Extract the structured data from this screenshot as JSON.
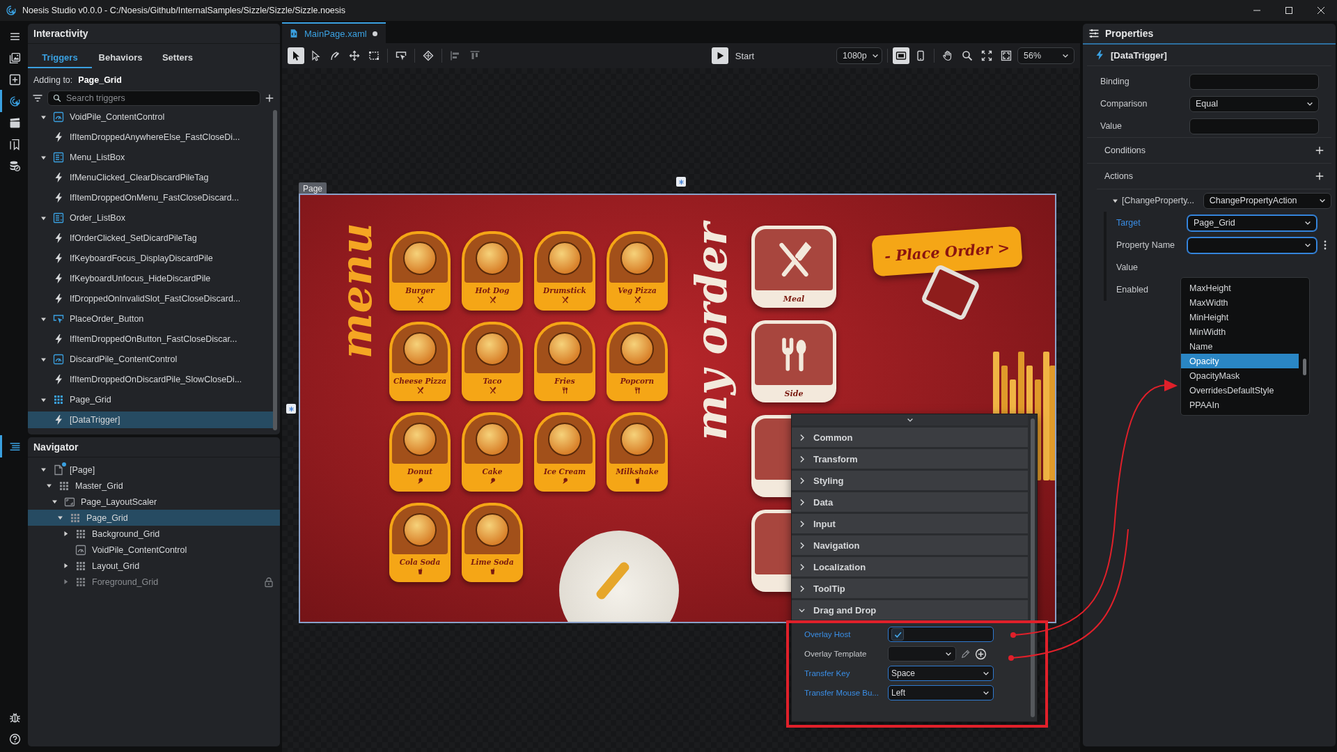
{
  "title_bar": {
    "title": "Noesis Studio v0.0.0 - C:/Noesis/Github/InternalSamples/Sizzle/Sizzle/Sizzle.noesis"
  },
  "activity_bar": {
    "panels": [
      {
        "kind": "menu",
        "selected": false
      },
      {
        "kind": "images",
        "selected": false
      },
      {
        "kind": "add",
        "selected": false
      },
      {
        "kind": "interactivity",
        "selected": true
      },
      {
        "kind": "film",
        "selected": false
      },
      {
        "kind": "pages",
        "selected": false
      },
      {
        "kind": "database",
        "selected": false
      }
    ],
    "navigator": [
      {
        "kind": "outline",
        "selected": true
      }
    ],
    "footer": [
      {
        "kind": "bug"
      },
      {
        "kind": "help"
      }
    ]
  },
  "interactivity": {
    "title": "Interactivity",
    "tabs": [
      {
        "label": "Triggers",
        "selected": true
      },
      {
        "label": "Behaviors",
        "selected": false
      },
      {
        "label": "Setters",
        "selected": false
      }
    ],
    "adding_to_label": "Adding to:",
    "adding_to_value": "Page_Grid",
    "search": {
      "placeholder": "Search triggers"
    },
    "tree": [
      {
        "label": "VoidPile_ContentControl",
        "kind": "contentcontrol",
        "expanded": true,
        "selected": false,
        "children": [
          {
            "label": "IfItemDroppedAnywhereElse_FastCloseDi...",
            "kind": "trigger",
            "selected": false
          }
        ]
      },
      {
        "label": "Menu_ListBox",
        "kind": "listbox",
        "expanded": true,
        "selected": false,
        "children": [
          {
            "label": "IfMenuClicked_ClearDiscardPileTag",
            "kind": "trigger",
            "selected": false
          },
          {
            "label": "IfItemDroppedOnMenu_FastCloseDiscard...",
            "kind": "trigger",
            "selected": false
          }
        ]
      },
      {
        "label": "Order_ListBox",
        "kind": "listbox",
        "expanded": true,
        "selected": false,
        "children": [
          {
            "label": "IfOrderClicked_SetDicardPileTag",
            "kind": "trigger",
            "selected": false
          },
          {
            "label": "IfKeyboardFocus_DisplayDiscardPile",
            "kind": "trigger",
            "selected": false
          },
          {
            "label": "IfKeyboardUnfocus_HideDiscardPile",
            "kind": "trigger",
            "selected": false
          },
          {
            "label": "IfDroppedOnInvalidSlot_FastCloseDiscard...",
            "kind": "trigger",
            "selected": false
          }
        ]
      },
      {
        "label": "PlaceOrder_Button",
        "kind": "button",
        "expanded": true,
        "selected": false,
        "children": [
          {
            "label": "IfItemDroppedOnButton_FastCloseDiscar...",
            "kind": "trigger",
            "selected": false
          }
        ]
      },
      {
        "label": "DiscardPile_ContentControl",
        "kind": "contentcontrol",
        "expanded": true,
        "selected": false,
        "children": [
          {
            "label": "IfItemDroppedOnDiscardPile_SlowCloseDi...",
            "kind": "trigger",
            "selected": false
          }
        ]
      },
      {
        "label": "Page_Grid",
        "kind": "grid",
        "expanded": true,
        "selected": false,
        "children": [
          {
            "label": "[DataTrigger]",
            "kind": "trigger",
            "selected": true
          }
        ]
      }
    ]
  },
  "navigator": {
    "title": "Navigator",
    "tree": [
      {
        "label": "[Page]",
        "kind": "page",
        "expanded": true,
        "selected": false,
        "locked": false,
        "modified": true,
        "children": [
          {
            "label": "Master_Grid",
            "kind": "grid",
            "expanded": true,
            "selected": false,
            "locked": false,
            "modified": false,
            "children": [
              {
                "label": "Page_LayoutScaler",
                "kind": "scaler",
                "expanded": true,
                "selected": false,
                "locked": false,
                "modified": false,
                "children": [
                  {
                    "label": "Page_Grid",
                    "kind": "grid",
                    "expanded": true,
                    "selected": true,
                    "locked": false,
                    "modified": false,
                    "children": [
                      {
                        "label": "Background_Grid",
                        "kind": "grid",
                        "expanded": false,
                        "selected": false,
                        "locked": false,
                        "modified": false
                      },
                      {
                        "label": "VoidPile_ContentControl",
                        "kind": "contentcontrol",
                        "selected": false,
                        "locked": false,
                        "modified": false
                      },
                      {
                        "label": "Layout_Grid",
                        "kind": "grid",
                        "expanded": false,
                        "selected": false,
                        "locked": false,
                        "modified": false
                      },
                      {
                        "label": "Foreground_Grid",
                        "kind": "grid",
                        "expanded": false,
                        "selected": false,
                        "locked": true,
                        "modified": false
                      }
                    ]
                  }
                ]
              }
            ]
          }
        ]
      }
    ]
  },
  "editor": {
    "tabs": [
      {
        "label": "MainPage.xaml",
        "selected": true,
        "modified": true
      }
    ],
    "toolbar": {
      "tools": [
        {
          "kind": "select",
          "selected": true
        },
        {
          "kind": "direct",
          "selected": false
        },
        {
          "kind": "pen",
          "selected": false
        },
        {
          "kind": "move",
          "selected": false
        },
        {
          "kind": "marquee",
          "selected": false
        },
        {
          "kind": "pointer-rect",
          "selected": false
        },
        {
          "kind": "diamond",
          "selected": false
        },
        {
          "kind": "align-left",
          "selected": false
        },
        {
          "kind": "align-top",
          "selected": false
        }
      ],
      "start_label": "Start",
      "resolution": "1080p",
      "devices": [
        {
          "kind": "desktop",
          "selected": true
        },
        {
          "kind": "mobile",
          "selected": false
        }
      ],
      "view_tools": [
        {
          "kind": "hand"
        },
        {
          "kind": "search"
        },
        {
          "kind": "fit"
        },
        {
          "kind": "fullscreen"
        }
      ],
      "zoom": "56%"
    },
    "canvas": {
      "page_label": "Page",
      "artwork": {
        "menu_title": "menu",
        "order_title": "my order",
        "place_order": "- Place Order >",
        "menu_items": [
          {
            "label": "Burger",
            "kind": "meal"
          },
          {
            "label": "Hot Dog",
            "kind": "meal"
          },
          {
            "label": "Drumstick",
            "kind": "meal"
          },
          {
            "label": "Veg Pizza",
            "kind": "meal"
          },
          {
            "label": "Cheese Pizza",
            "kind": "meal"
          },
          {
            "label": "Taco",
            "kind": "meal"
          },
          {
            "label": "Fries",
            "kind": "side"
          },
          {
            "label": "Popcorn",
            "kind": "side"
          },
          {
            "label": "Donut",
            "kind": "dessert"
          },
          {
            "label": "Cake",
            "kind": "dessert"
          },
          {
            "label": "Ice Cream",
            "kind": "dessert"
          },
          {
            "label": "Milkshake",
            "kind": "drink"
          },
          {
            "label": "Cola Soda",
            "kind": "drink"
          },
          {
            "label": "Lime Soda",
            "kind": "drink"
          }
        ],
        "order_slots": [
          {
            "label": "Meal",
            "kind": "meal"
          },
          {
            "label": "Side",
            "kind": "side"
          },
          {
            "kind": "drink"
          },
          {
            "kind": "dessert"
          }
        ]
      },
      "property_popup": {
        "categories": [
          {
            "label": "Common",
            "expanded": false
          },
          {
            "label": "Transform",
            "expanded": false
          },
          {
            "label": "Styling",
            "expanded": false
          },
          {
            "label": "Data",
            "expanded": false
          },
          {
            "label": "Input",
            "expanded": false
          },
          {
            "label": "Navigation",
            "expanded": false
          },
          {
            "label": "Localization",
            "expanded": false
          },
          {
            "label": "ToolTip",
            "expanded": false
          },
          {
            "label": "Drag and Drop",
            "expanded": true
          }
        ],
        "fields": [
          {
            "label": "Overlay Host",
            "kind": "checkbox",
            "is_set": true,
            "checked": true
          },
          {
            "label": "Overlay Template",
            "kind": "template",
            "is_set": false
          },
          {
            "label": "Transfer Key",
            "kind": "dropdown",
            "is_set": true,
            "value": "Space"
          },
          {
            "label": "Transfer Mouse Bu...",
            "kind": "dropdown",
            "is_set": true,
            "value": "Left"
          }
        ]
      }
    }
  },
  "properties": {
    "title": "Properties",
    "object": "[DataTrigger]",
    "fields": [
      {
        "label": "Binding",
        "kind": "text",
        "active": false
      },
      {
        "label": "Comparison",
        "kind": "dropdown",
        "value": "Equal",
        "active": false
      },
      {
        "label": "Value",
        "kind": "text",
        "active": false
      }
    ],
    "sections": [
      {
        "label": "Conditions"
      },
      {
        "label": "Actions"
      }
    ],
    "action": {
      "label": "[ChangeProperty...",
      "value": "ChangePropertyAction",
      "expanded": true,
      "fields": [
        {
          "label": "Target",
          "kind": "dropdown",
          "value": "Page_Grid",
          "is_set": true,
          "active": true
        },
        {
          "label": "Property Name",
          "kind": "dropdown",
          "is_set": false,
          "active": true
        },
        {
          "label": "Value",
          "kind": "covered",
          "is_set": false
        },
        {
          "label": "Enabled",
          "kind": "covered",
          "is_set": false
        }
      ]
    },
    "dropdown_options": [
      {
        "label": "MaxHeight",
        "selected": false
      },
      {
        "label": "MaxWidth",
        "selected": false
      },
      {
        "label": "MinHeight",
        "selected": false
      },
      {
        "label": "MinWidth",
        "selected": false
      },
      {
        "label": "Name",
        "selected": false
      },
      {
        "label": "Opacity",
        "selected": true
      },
      {
        "label": "OpacityMask",
        "selected": false
      },
      {
        "label": "OverridesDefaultStyle",
        "selected": false
      },
      {
        "label": "PPAAIn",
        "selected": false
      }
    ]
  }
}
